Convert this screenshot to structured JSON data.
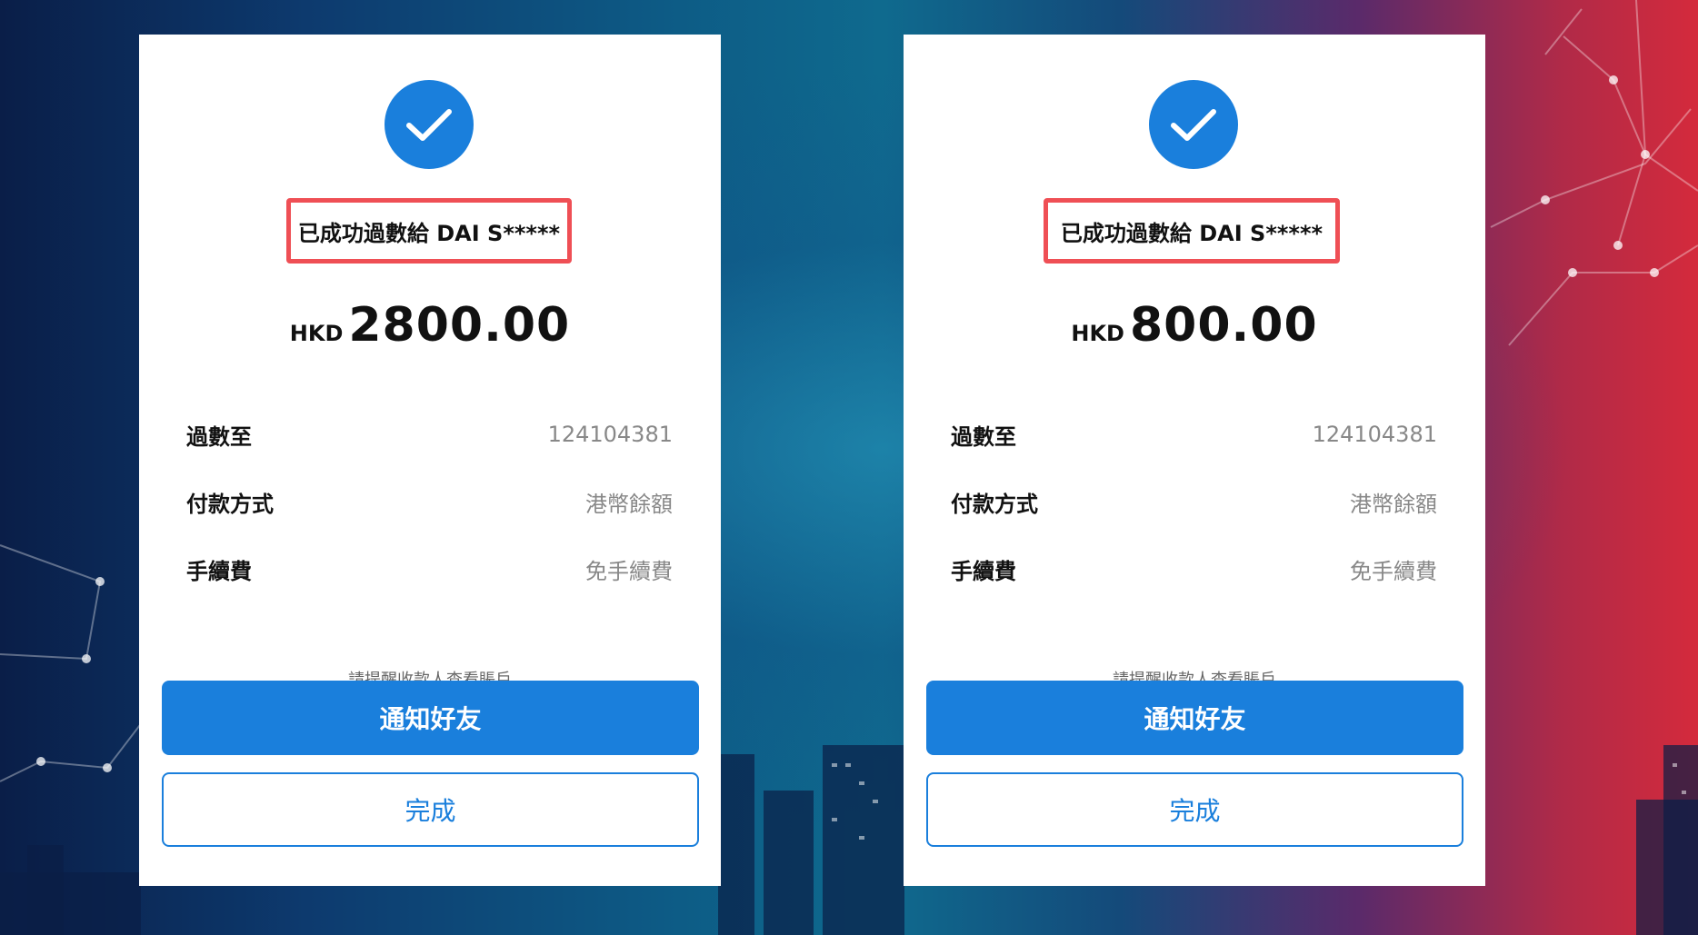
{
  "colors": {
    "accent": "#1a7fdc",
    "highlight_border": "#ef4f55",
    "label_text": "#111111",
    "value_text": "#888888"
  },
  "cards": [
    {
      "icon": "checkmark-circle-icon",
      "headline": "已成功過數給 DAI S*****",
      "currency": "HKD",
      "amount": "2800.00",
      "details": [
        {
          "label": "過數至",
          "value": "124104381"
        },
        {
          "label": "付款方式",
          "value": "港幣餘額"
        },
        {
          "label": "手續費",
          "value": "免手續費"
        }
      ],
      "notice": "請提醒收款人查看賬戶",
      "primary_button": "通知好友",
      "secondary_button": "完成"
    },
    {
      "icon": "checkmark-circle-icon",
      "headline": "已成功過數給 DAI S*****",
      "currency": "HKD",
      "amount": "800.00",
      "details": [
        {
          "label": "過數至",
          "value": "124104381"
        },
        {
          "label": "付款方式",
          "value": "港幣餘額"
        },
        {
          "label": "手續費",
          "value": "免手續費"
        }
      ],
      "notice": "請提醒收款人查看賬戶",
      "primary_button": "通知好友",
      "secondary_button": "完成"
    }
  ]
}
